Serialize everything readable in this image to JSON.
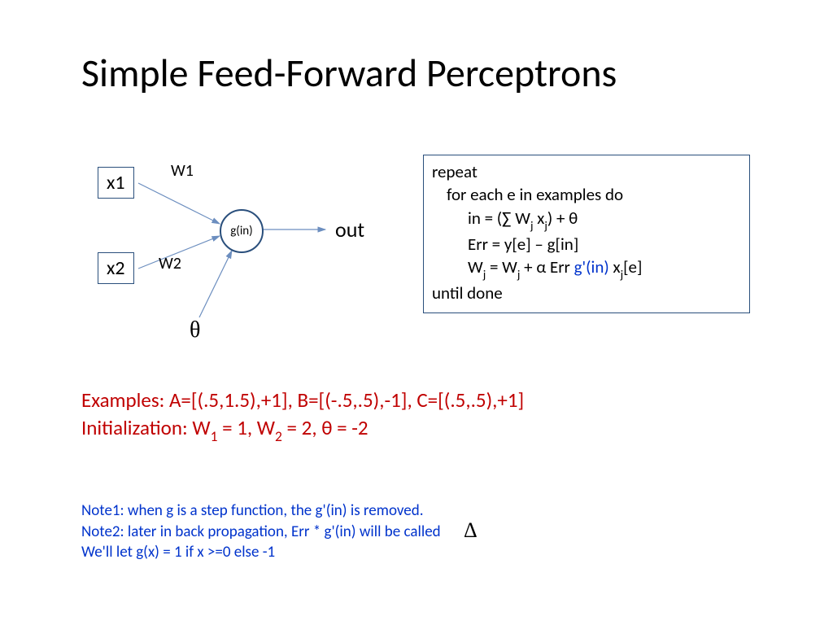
{
  "title": "Simple Feed-Forward Perceptrons",
  "diagram": {
    "x1": "x1",
    "x2": "x2",
    "w1": "W1",
    "w2": "W2",
    "node": "g(in)",
    "theta": "θ",
    "out": "out"
  },
  "algo": {
    "l1": "repeat",
    "l2": "for each e in examples do",
    "l3_a": "in = (∑ W",
    "l3_b": " x",
    "l3_c": ") + θ",
    "l4": "Err = y[e] – g[in]",
    "l5_a": "W",
    "l5_b": " = W",
    "l5_c": " + α Err ",
    "l5_g": "g'(in)",
    "l5_d": " x",
    "l5_e": "[e]",
    "l6": "until done",
    "sub_j": "j"
  },
  "examples": {
    "line1": "Examples: A=[(.5,1.5),+1], B=[(-.5,.5),-1], C=[(.5,.5),+1]",
    "line2_a": "Initialization: W",
    "line2_b": " = 1, W",
    "line2_c": " = 2, θ = -2",
    "sub_1": "1",
    "sub_2": "2"
  },
  "notes": {
    "n1": "Note1: when g is a step function, the g'(in) is removed.",
    "n2": "Note2: later in back propagation, Err * g'(in) will be called",
    "n3": "We'll let g(x) = 1 if x >=0 else -1"
  },
  "delta": "Δ"
}
